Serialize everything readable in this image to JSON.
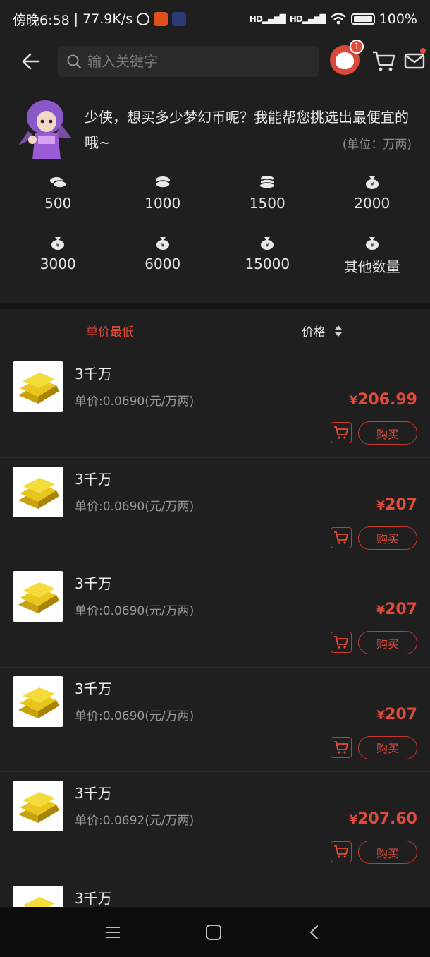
{
  "status_bar": {
    "time": "傍晚6:58",
    "speed": "77.9K/s",
    "battery": "100%",
    "sig1": "HD",
    "sig2": "HD"
  },
  "header": {
    "search_placeholder": "输入关键字",
    "avatar_badge": "1"
  },
  "intro": {
    "text": "少侠，想买多少梦幻币呢？我能帮您挑选出最便宜的哦~",
    "unit_note": "(单位：万两)"
  },
  "amounts": [
    {
      "label": "500",
      "icon": "coin-stack-icon"
    },
    {
      "label": "1000",
      "icon": "coin-stack-icon"
    },
    {
      "label": "1500",
      "icon": "coin-stack-icon"
    },
    {
      "label": "2000",
      "icon": "money-bag-icon"
    },
    {
      "label": "3000",
      "icon": "money-bag-icon"
    },
    {
      "label": "6000",
      "icon": "money-bag-icon"
    },
    {
      "label": "15000",
      "icon": "money-bag-icon"
    },
    {
      "label": "其他数量",
      "icon": "money-bag-icon"
    }
  ],
  "sort": {
    "lowest_unit_price": "单价最低",
    "price": "价格"
  },
  "items": [
    {
      "name": "3千万",
      "unit_price": "单价:0.0690(元/万两)",
      "currency": "¥",
      "price": "206.99",
      "buy": "购买"
    },
    {
      "name": "3千万",
      "unit_price": "单价:0.0690(元/万两)",
      "currency": "¥",
      "price": "207",
      "buy": "购买"
    },
    {
      "name": "3千万",
      "unit_price": "单价:0.0690(元/万两)",
      "currency": "¥",
      "price": "207",
      "buy": "购买"
    },
    {
      "name": "3千万",
      "unit_price": "单价:0.0690(元/万两)",
      "currency": "¥",
      "price": "207",
      "buy": "购买"
    },
    {
      "name": "3千万",
      "unit_price": "单价:0.0692(元/万两)",
      "currency": "¥",
      "price": "207.60",
      "buy": "购买"
    },
    {
      "name": "3千万",
      "unit_price": "",
      "currency": "",
      "price": "",
      "buy": ""
    }
  ],
  "colors": {
    "accent": "#e24a3b",
    "background": "#1f1f20",
    "gold": "#e6c21a"
  }
}
